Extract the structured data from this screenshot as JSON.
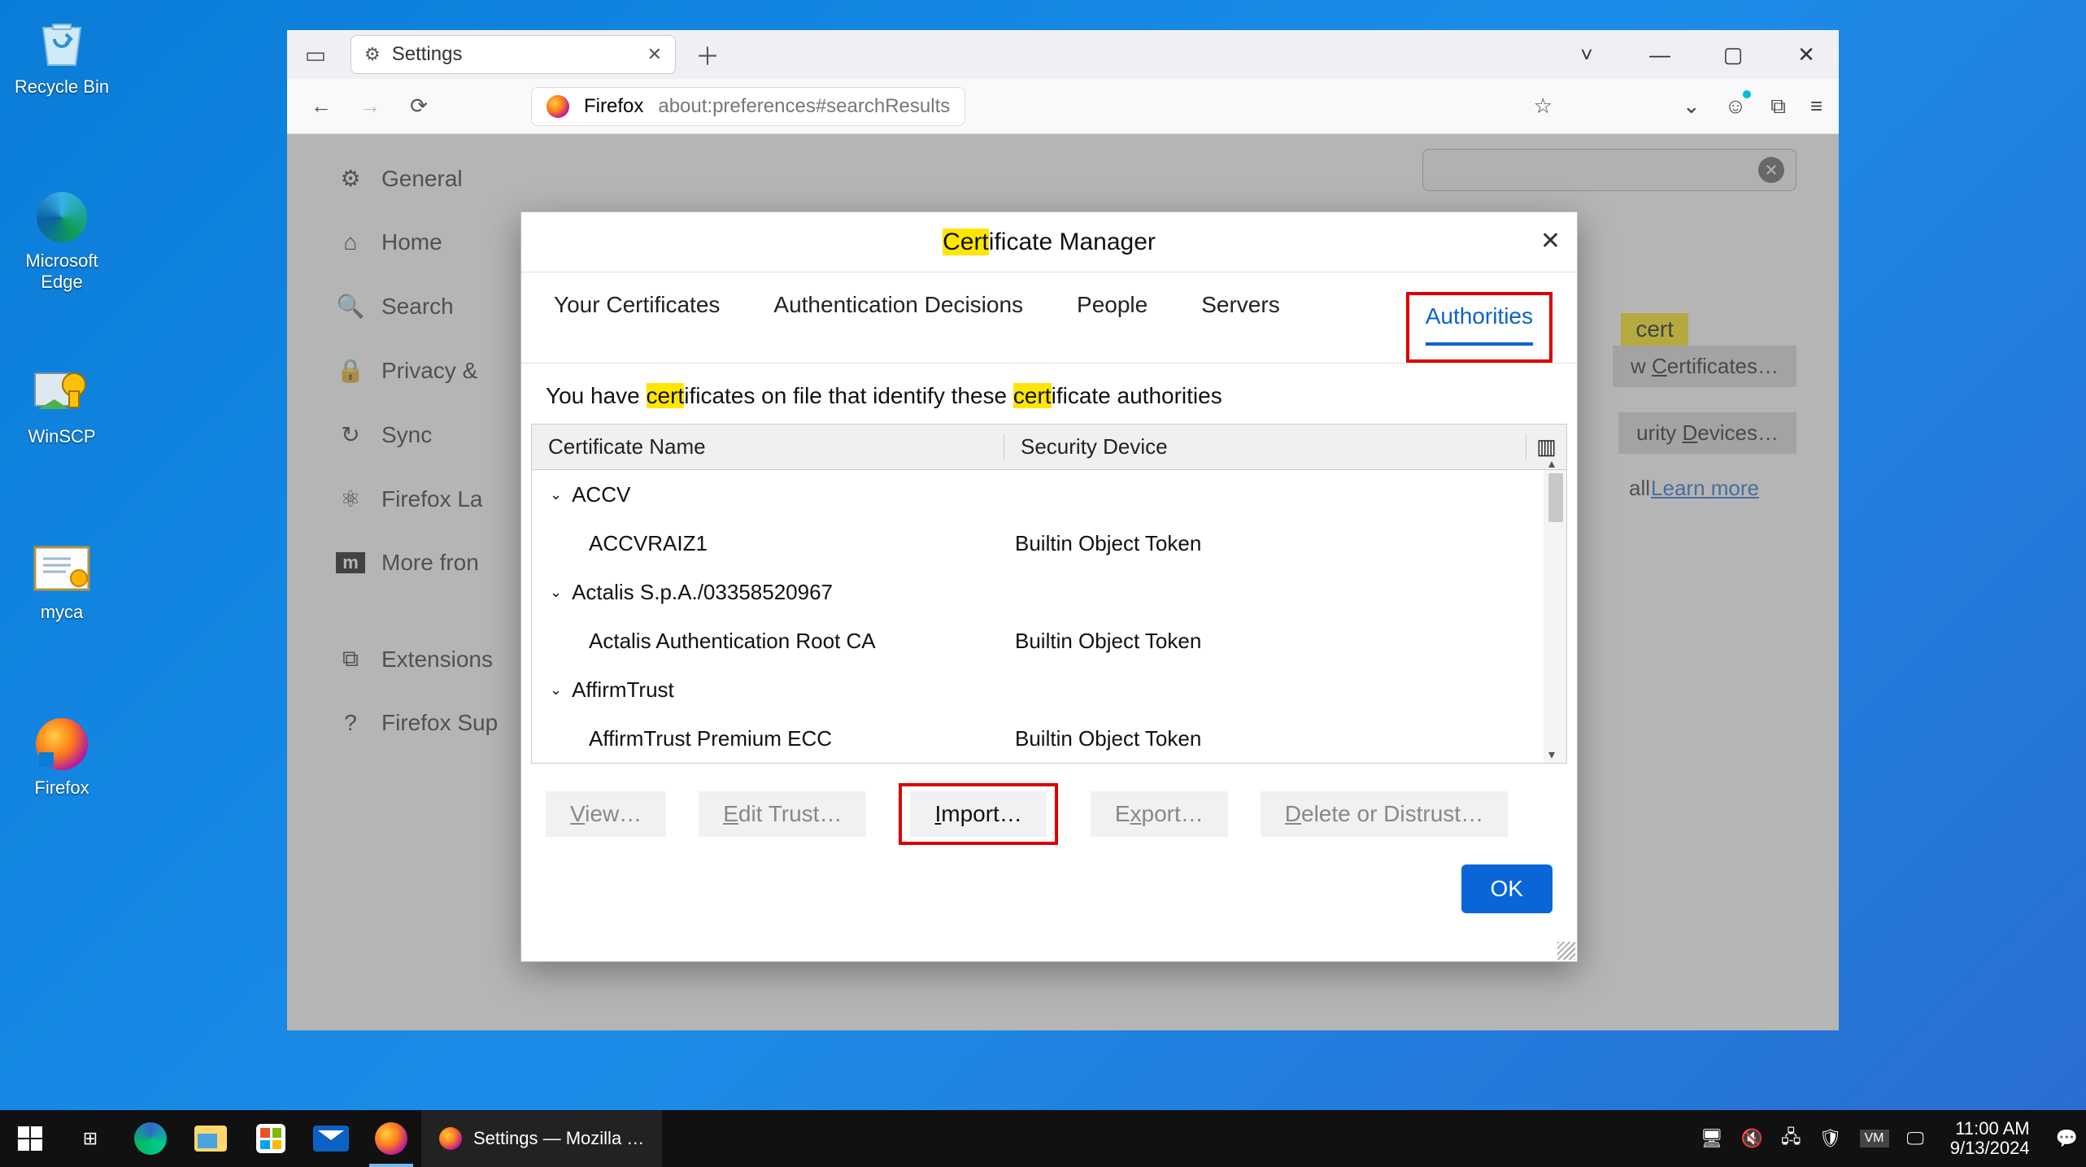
{
  "desktop": {
    "icons": [
      {
        "name": "recycle-bin",
        "label": "Recycle Bin"
      },
      {
        "name": "edge",
        "label": "Microsoft Edge"
      },
      {
        "name": "winscp",
        "label": "WinSCP"
      },
      {
        "name": "myca",
        "label": "myca"
      },
      {
        "name": "firefox",
        "label": "Firefox"
      }
    ]
  },
  "firefox_window": {
    "tab_label": "Settings",
    "address_domain": "Firefox",
    "address_path": "about:preferences#searchResults",
    "win_btns": {
      "drop": "˅",
      "min": "—",
      "max": "▢",
      "close": "✕"
    }
  },
  "settings_page": {
    "sidebar": [
      "General",
      "Home",
      "Search",
      "Privacy &",
      "Sync",
      "Firefox La",
      "More fron",
      "Extensions",
      "Firefox Sup"
    ],
    "search_badge": "cert",
    "view_certs_btn_pre": "w ",
    "view_certs_btn": "Certificates…",
    "sec_devices_btn_pre": "urity ",
    "sec_devices_btn": "Devices…",
    "all_text": "all",
    "learn_more": "Learn more"
  },
  "cert_manager": {
    "title_pre": "Cert",
    "title_post": "ificate Manager",
    "tabs": [
      "Your Certificates",
      "Authentication Decisions",
      "People",
      "Servers",
      "Authorities"
    ],
    "active_tab": "Authorities",
    "description": {
      "p1": "You have ",
      "h1": "cert",
      "p2": "ificates on file that identify these ",
      "h2": "cert",
      "p3": "ificate authorities"
    },
    "columns": {
      "name": "Certificate Name",
      "device": "Security Device"
    },
    "rows": [
      {
        "type": "group",
        "name": "ACCV"
      },
      {
        "type": "leaf",
        "name": "ACCVRAIZ1",
        "device": "Builtin Object Token"
      },
      {
        "type": "group",
        "name": "Actalis S.p.A./03358520967"
      },
      {
        "type": "leaf",
        "name": "Actalis Authentication Root CA",
        "device": "Builtin Object Token"
      },
      {
        "type": "group",
        "name": "AffirmTrust"
      },
      {
        "type": "leaf",
        "name": "AffirmTrust Premium ECC",
        "device": "Builtin Object Token"
      }
    ],
    "buttons": {
      "view": "View…",
      "edit": "Edit Trust…",
      "import": "Import…",
      "export": "Export…",
      "delete": "Delete or Distrust…",
      "ok": "OK"
    }
  },
  "taskbar": {
    "active_task": "Settings — Mozilla …",
    "clock": {
      "time": "11:00 AM",
      "date": "9/13/2024"
    }
  }
}
